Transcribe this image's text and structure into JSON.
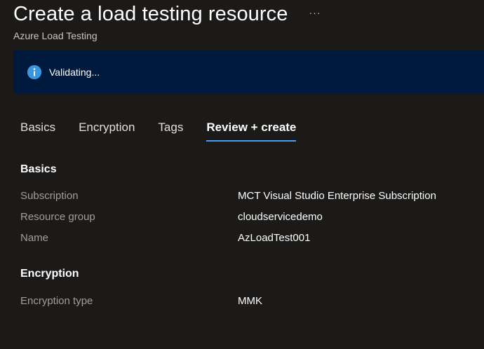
{
  "header": {
    "title": "Create a load testing resource",
    "more_label": "···",
    "subtitle": "Azure Load Testing"
  },
  "banner": {
    "icon": "info-icon",
    "text": "Validating..."
  },
  "tabs": [
    {
      "label": "Basics",
      "active": false
    },
    {
      "label": "Encryption",
      "active": false
    },
    {
      "label": "Tags",
      "active": false
    },
    {
      "label": "Review + create",
      "active": true
    }
  ],
  "sections": {
    "basics": {
      "heading": "Basics",
      "rows": [
        {
          "label": "Subscription",
          "value": "MCT Visual Studio Enterprise Subscription"
        },
        {
          "label": "Resource group",
          "value": "cloudservicedemo"
        },
        {
          "label": "Name",
          "value": "AzLoadTest001"
        }
      ]
    },
    "encryption": {
      "heading": "Encryption",
      "rows": [
        {
          "label": "Encryption type",
          "value": "MMK"
        }
      ]
    }
  },
  "colors": {
    "background": "#1b1a19",
    "banner": "#001a3d",
    "accent": "#479ef5",
    "info_icon": "#3a96dd",
    "label_gray": "#a19f9d"
  }
}
